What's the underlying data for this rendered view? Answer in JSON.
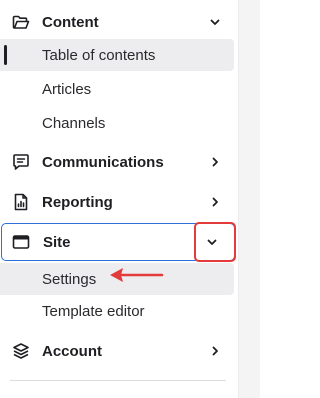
{
  "nav": {
    "content": {
      "label": "Content",
      "icon": "folder-open-icon",
      "expanded": true,
      "items": [
        {
          "label": "Table of contents",
          "active": true
        },
        {
          "label": "Articles"
        },
        {
          "label": "Channels"
        }
      ]
    },
    "communications": {
      "label": "Communications",
      "icon": "chat-icon"
    },
    "reporting": {
      "label": "Reporting",
      "icon": "report-document-icon"
    },
    "site": {
      "label": "Site",
      "icon": "browser-window-icon",
      "expanded": true,
      "focused": true,
      "items": [
        {
          "label": "Settings",
          "selected": true
        },
        {
          "label": "Template editor"
        }
      ]
    },
    "account": {
      "label": "Account",
      "icon": "layers-icon"
    }
  },
  "annotations": {
    "highlight_color": "#e23b3b",
    "focus_color": "#2f6fdc"
  }
}
